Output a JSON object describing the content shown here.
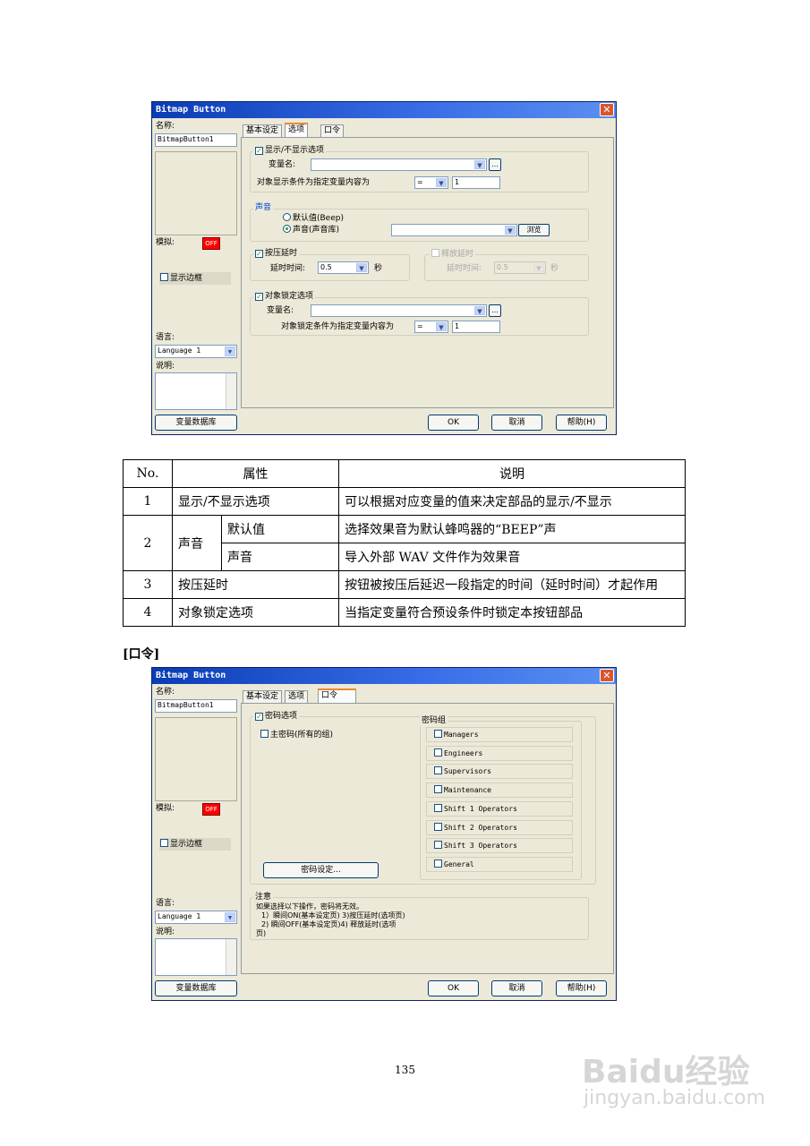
{
  "dialog1": {
    "title": "Bitmap Button",
    "close": "✕",
    "name_label": "名称:",
    "name_value": "BitmapButton1",
    "simulate_label": "模拟:",
    "off_button": "OFF",
    "show_border": "显示边框",
    "language_label": "语言:",
    "language_value": "Language 1",
    "desc_label": "说明:",
    "tag_db_button": "变量数据库",
    "tabs": [
      "基本设定",
      "选项",
      "口令"
    ],
    "show_hide_group": "显示/不显示选项",
    "var_name_label": "变量名:",
    "cond_label": "对象显示条件为指定变量内容为",
    "cond_op": "=",
    "cond_value": "1",
    "browse_small": "...",
    "sound_group": "声音",
    "sound_default": "默认值(Beep)",
    "sound_library": "声音(声音库)",
    "browse_button": "浏览",
    "press_delay_group": "按压延时",
    "delay_label": "延时时间:",
    "delay_value": "0.5",
    "seconds": "秒",
    "release_delay_group": "释放延时",
    "release_delay_label": "延时时间:",
    "release_delay_value": "0.5",
    "release_seconds": "秒",
    "lock_group": "对象锁定选项",
    "lock_var_label": "变量名:",
    "lock_cond_label": "对象锁定条件为指定变量内容为",
    "lock_op": "=",
    "lock_value": "1",
    "ok": "OK",
    "cancel": "取消",
    "help": "帮助(H)"
  },
  "table": {
    "headers": [
      "No.",
      "属性",
      "说明"
    ],
    "rows": [
      {
        "no": "1",
        "prop": "显示/不显示选项",
        "desc": "可以根据对应变量的值来决定部品的显示/不显示"
      },
      {
        "no": "2",
        "prop": "声音",
        "sub1": "默认值",
        "desc1": "选择效果音为默认蜂鸣器的“BEEP”声",
        "sub2": "声音",
        "desc2": "导入外部 WAV 文件作为效果音"
      },
      {
        "no": "3",
        "prop": "按压延时",
        "desc": "按钮被按压后延迟一段指定的时间（延时时间）才起作用"
      },
      {
        "no": "4",
        "prop": "对象锁定选项",
        "desc": "当指定变量符合预设条件时锁定本按钮部品"
      }
    ]
  },
  "section_heading": "[口令]",
  "dialog2": {
    "title": "Bitmap Button",
    "close": "✕",
    "name_label": "名称:",
    "name_value": "BitmapButton1",
    "simulate_label": "模拟:",
    "off_button": "OFF",
    "show_border": "显示边框",
    "language_label": "语言:",
    "language_value": "Language 1",
    "desc_label": "说明:",
    "tag_db_button": "变量数据库",
    "tabs": [
      "基本设定",
      "选项",
      "口令"
    ],
    "password_option": "密码选项",
    "master_password": "主密码(所有的组)",
    "password_groups_title": "密码组",
    "password_groups": [
      "Managers",
      "Engineers",
      "Supervisors",
      "Maintenance",
      "Shift 1 Operators",
      "Shift 2 Operators",
      "Shift 3 Operators",
      "General"
    ],
    "password_settings_button": "密码设定...",
    "note_title": "注意",
    "note_line1": "如果选择以下操作，密码将无效。",
    "note_line2": "1）瞬间ON(基本设定页) 3)按压延时(选项页)",
    "note_line3": "2) 瞬间OFF(基本设定页)4) 释放延时(选项",
    "note_line4": "页)",
    "ok": "OK",
    "cancel": "取消",
    "help": "帮助(H)"
  },
  "page_number": "135",
  "watermark": {
    "logo": "Baidu经验",
    "url": "jingyan.baidu.com"
  }
}
